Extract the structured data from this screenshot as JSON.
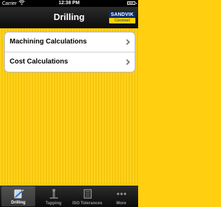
{
  "status_bar": {
    "carrier": "Carrier",
    "time": "12:38 PM",
    "wifi_icon": "wifi-icon",
    "battery_icon": "battery-icon"
  },
  "nav_bar": {
    "title": "Drilling",
    "logo_name": "SANDVIK",
    "logo_sub": "Coromant"
  },
  "menu": {
    "items": [
      {
        "label": "Machining Calculations",
        "icon": "chevron-right-icon"
      },
      {
        "label": "Cost Calculations",
        "icon": "chevron-right-icon"
      }
    ]
  },
  "tab_bar": {
    "active": "Drilling",
    "tabs": [
      {
        "label": "Drilling",
        "icon": "drill-icon"
      },
      {
        "label": "Tapping",
        "icon": "tap-icon"
      },
      {
        "label": "ISO Tolerances",
        "icon": "tolerance-icon"
      },
      {
        "label": "More",
        "icon": "more-icon"
      }
    ]
  },
  "colors": {
    "background": "#ffcf10",
    "nav_bar": "#1a1a1a",
    "logo_blue": "#0a2e6e"
  }
}
